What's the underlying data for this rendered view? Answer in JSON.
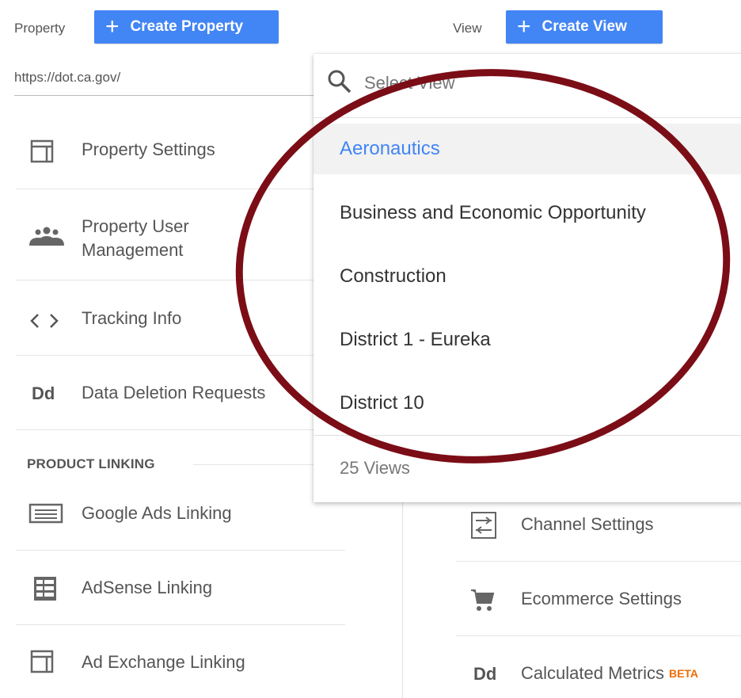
{
  "property": {
    "label": "Property",
    "create_label": "Create Property",
    "url": "https://dot.ca.gov/"
  },
  "view": {
    "label": "View",
    "create_label": "Create View"
  },
  "left_menu": [
    {
      "name": "property-settings",
      "label": "Property Settings",
      "icon": "layout-icon"
    },
    {
      "name": "property-user-management",
      "label": "Property User Management",
      "icon": "people-icon"
    },
    {
      "name": "tracking-info",
      "label": "Tracking Info",
      "icon": "code-icon"
    },
    {
      "name": "data-deletion-requests",
      "label": "Data Deletion Requests",
      "icon": "dd-icon"
    }
  ],
  "product_linking": {
    "heading": "PRODUCT LINKING",
    "items": [
      {
        "label": "Google Ads Linking",
        "icon": "ads-icon"
      },
      {
        "label": "AdSense Linking",
        "icon": "adsense-icon"
      },
      {
        "label": "Ad Exchange Linking",
        "icon": "layout-icon"
      }
    ]
  },
  "right_menu": [
    {
      "label": "Channel Settings",
      "icon": "channel-icon"
    },
    {
      "label": "Ecommerce Settings",
      "icon": "cart-icon"
    },
    {
      "label": "Calculated Metrics",
      "icon": "dd-icon",
      "badge": "BETA"
    }
  ],
  "dropdown": {
    "search_placeholder": "Select View",
    "options": [
      "Aeronautics",
      "Business and Economic Opportunity",
      "Construction",
      "District 1 - Eureka",
      "District 10"
    ],
    "selected": "Aeronautics",
    "footer": "25 Views"
  },
  "annotation_color": "#7b0d16",
  "accent_color": "#4285f4"
}
